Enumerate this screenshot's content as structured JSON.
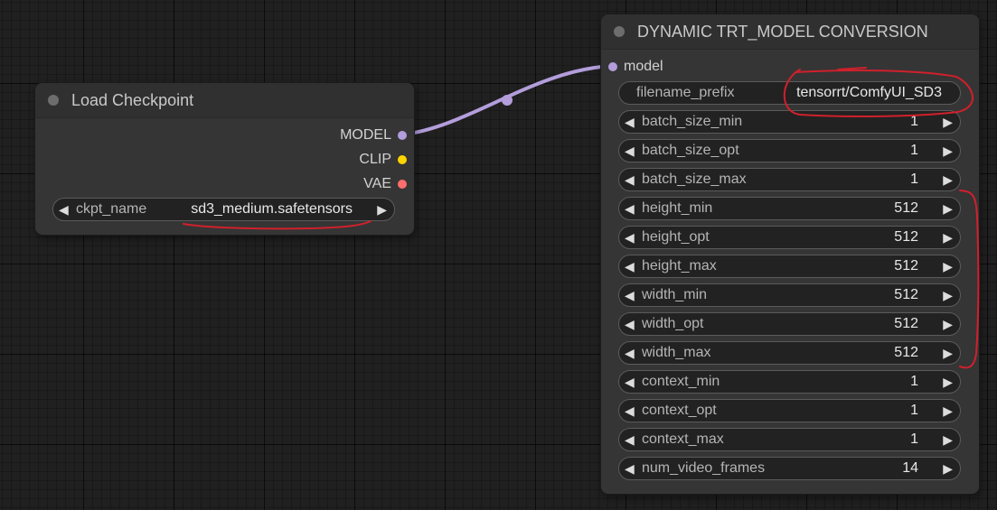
{
  "colors": {
    "link": "#b39ddb",
    "model_socket": "#b39ddb",
    "clip_socket": "#ffd500",
    "vae_socket": "#ff6e6e",
    "annotation": "#d0202c"
  },
  "load_checkpoint": {
    "title": "Load Checkpoint",
    "outputs": [
      {
        "label": "MODEL"
      },
      {
        "label": "CLIP"
      },
      {
        "label": "VAE"
      }
    ],
    "ckpt_widget": {
      "label": "ckpt_name",
      "value": "sd3_medium.safetensors"
    }
  },
  "trt_node": {
    "title": "DYNAMIC TRT_MODEL CONVERSION",
    "input_label": "model",
    "filename_prefix": {
      "label": "filename_prefix",
      "value": "tensorrt/ComfyUI_SD3"
    },
    "widgets": [
      {
        "label": "batch_size_min",
        "value": "1"
      },
      {
        "label": "batch_size_opt",
        "value": "1"
      },
      {
        "label": "batch_size_max",
        "value": "1"
      },
      {
        "label": "height_min",
        "value": "512"
      },
      {
        "label": "height_opt",
        "value": "512"
      },
      {
        "label": "height_max",
        "value": "512"
      },
      {
        "label": "width_min",
        "value": "512"
      },
      {
        "label": "width_opt",
        "value": "512"
      },
      {
        "label": "width_max",
        "value": "512"
      },
      {
        "label": "context_min",
        "value": "1"
      },
      {
        "label": "context_opt",
        "value": "1"
      },
      {
        "label": "context_max",
        "value": "1"
      },
      {
        "label": "num_video_frames",
        "value": "14"
      }
    ]
  }
}
